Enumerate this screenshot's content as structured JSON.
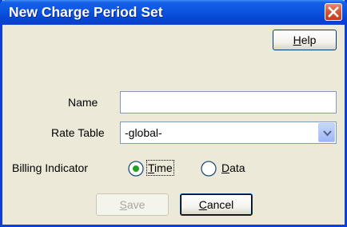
{
  "window": {
    "title": "New Charge Period Set"
  },
  "help_button": {
    "label": "Help",
    "mnemonic": "H",
    "rest": "elp"
  },
  "form": {
    "name": {
      "label": "Name",
      "value": ""
    },
    "rate_table": {
      "label": "Rate Table",
      "value": "-global-"
    },
    "billing_indicator": {
      "label": "Billing Indicator",
      "options": [
        {
          "label": "Time",
          "mnemonic": "T",
          "rest": "ime",
          "selected": true
        },
        {
          "label": "Data",
          "mnemonic": "D",
          "rest": "ata",
          "selected": false
        }
      ]
    }
  },
  "buttons": {
    "save": {
      "label": "Save",
      "mnemonic": "S",
      "rest": "ave",
      "enabled": false
    },
    "cancel": {
      "label": "Cancel",
      "mnemonic": "C",
      "rest": "ancel",
      "enabled": true
    }
  },
  "icons": {
    "close": "close-icon",
    "dropdown": "chevron-down-icon"
  },
  "colors": {
    "titlebar": "#0b55e0",
    "window_face": "#ece9d8",
    "close_button": "#d8583a",
    "field_border": "#7f9db9",
    "radio_dot": "#21a121"
  }
}
